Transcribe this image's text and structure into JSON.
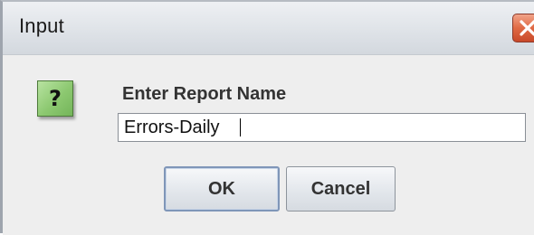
{
  "dialog": {
    "title": "Input",
    "close_icon": "close-x-icon"
  },
  "content": {
    "icon": "question-icon",
    "icon_glyph": "?",
    "prompt": "Enter Report Name",
    "input_value": "Errors-Daily"
  },
  "buttons": {
    "ok_label": "OK",
    "cancel_label": "Cancel"
  },
  "colors": {
    "icon_green": "#8cc870",
    "close_red": "#e06a45",
    "default_button_border": "#7f96b8"
  }
}
